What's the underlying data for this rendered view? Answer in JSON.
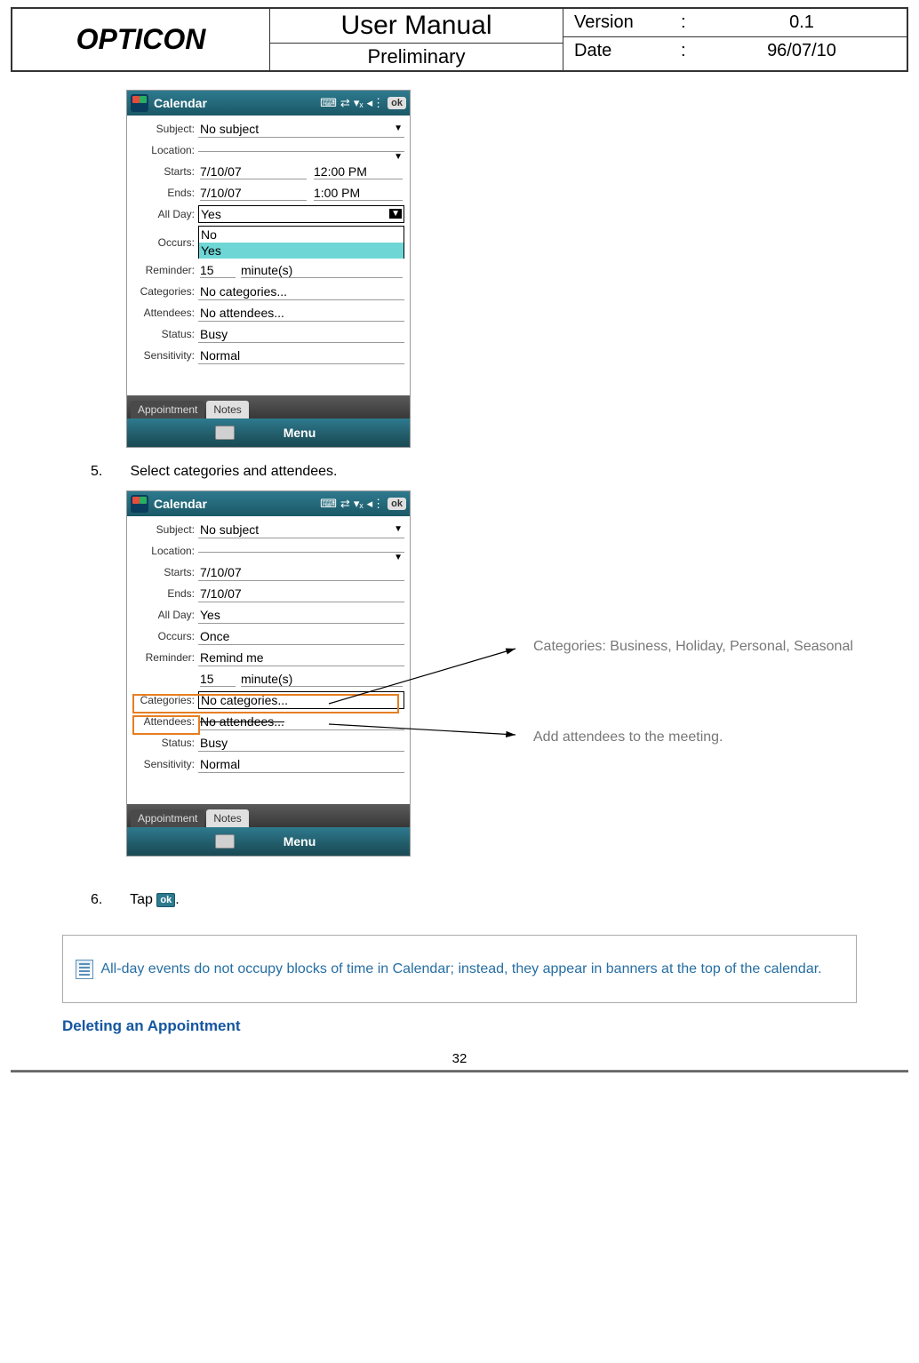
{
  "header": {
    "brand": "OPTICON",
    "title": "User Manual",
    "subtitle": "Preliminary",
    "version_label": "Version",
    "version_value": "0.1",
    "date_label": "Date",
    "date_value": "96/07/10"
  },
  "screen1": {
    "title": "Calendar",
    "ok": "ok",
    "labels": {
      "subject": "Subject:",
      "location": "Location:",
      "starts": "Starts:",
      "ends": "Ends:",
      "allday": "All Day:",
      "occurs": "Occurs:",
      "reminder": "Reminder:",
      "categories": "Categories:",
      "attendees": "Attendees:",
      "status": "Status:",
      "sensitivity": "Sensitivity:"
    },
    "values": {
      "subject": "No subject",
      "starts_date": "7/10/07",
      "starts_time": "12:00 PM",
      "ends_date": "7/10/07",
      "ends_time": "1:00 PM",
      "allday_sel": "Yes",
      "occurs_no": "No",
      "occurs_yes": "Yes",
      "reminder_qty": "15",
      "reminder_unit": "minute(s)",
      "categories": "No categories...",
      "attendees": "No attendees...",
      "status": "Busy",
      "sensitivity": "Normal"
    },
    "tabs": {
      "appointment": "Appointment",
      "notes": "Notes"
    },
    "menu": "Menu"
  },
  "step5": {
    "num": "5.",
    "text": "Select categories and attendees."
  },
  "screen2": {
    "title": "Calendar",
    "ok": "ok",
    "labels": {
      "subject": "Subject:",
      "location": "Location:",
      "starts": "Starts:",
      "ends": "Ends:",
      "allday": "All Day:",
      "occurs": "Occurs:",
      "reminder": "Reminder:",
      "categories": "Categories:",
      "attendees": "Attendees:",
      "status": "Status:",
      "sensitivity": "Sensitivity:"
    },
    "values": {
      "subject": "No subject",
      "starts_date": "7/10/07",
      "ends_date": "7/10/07",
      "allday": "Yes",
      "occurs": "Once",
      "reminder": "Remind me",
      "reminder_qty": "15",
      "reminder_unit": "minute(s)",
      "categories": "No categories...",
      "attendees": "No attendees...",
      "status": "Busy",
      "sensitivity": "Normal"
    },
    "tabs": {
      "appointment": "Appointment",
      "notes": "Notes"
    },
    "menu": "Menu"
  },
  "annotations": {
    "categories": "Categories: Business, Holiday, Personal, Seasonal",
    "attendees": "Add attendees to the meeting."
  },
  "step6": {
    "num": "6.",
    "text_before": "Tap ",
    "ok": "ok",
    "text_after": "."
  },
  "note": {
    "text": "All-day events do not occupy blocks of time in Calendar; instead, they appear in banners at the top of the calendar."
  },
  "section_title": "Deleting an Appointment",
  "page_number": "32"
}
